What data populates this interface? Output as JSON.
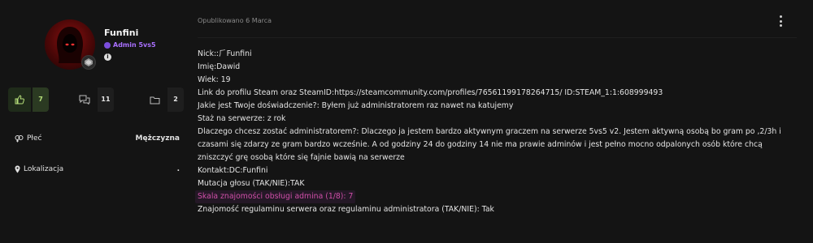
{
  "author": {
    "name": "Funfini",
    "role": "Admin 5vs5",
    "info_glyph": "i"
  },
  "stats": {
    "likes": "7",
    "comments": "11",
    "folders": "2"
  },
  "fields": {
    "gender_label": "Płeć",
    "gender_value": "Mężczyzna",
    "location_label": "Lokalizacja",
    "location_value": "."
  },
  "post": {
    "date": "Opublikowano 6 Marca",
    "lines": [
      "Nick:ː⺁Funfini",
      "Imię:Dawid",
      "Wiek: 19",
      "Link do profilu Steam oraz SteamID:https://steamcommunity.com/profiles/76561199178264715/ ID:STEAM_1:1:608999493",
      "Jakie jest Twoje doświadczenie?: Byłem już administratorem raz nawet na katujemy",
      "Staż na serwerze: z rok",
      "Dlaczego chcesz zostać administratorem?: Dlaczego ja jestem bardzo aktywnym graczem na serwerze 5vs5 v2. Jestem aktywną osobą bo gram po ,2/3h i  czasami się zdarzy ze gram bardzo wcześnie. A od godziny 24 do godziny 14 nie ma prawie adminów i jest pełno mocno odpalonych osób które chcą zniszczyć grę osobą które się fajnie bawią na serwerze",
      "Kontakt:DC:Funfini",
      "Mutacja głosu (TAK/NIE):TAK",
      "Skala znajomości obsługi admina (1/8): 7",
      "Znajomość regulaminu serwera oraz regulaminu administratora (TAK/NIE): Tak"
    ]
  },
  "colors": {
    "background": "#141414",
    "role": "#a970ff",
    "highlight_text": "#d04fa8",
    "like_accent": "#b7e07a"
  },
  "icons": [
    "thumbs-up-icon",
    "comments-icon",
    "folder-icon",
    "gender-icon",
    "location-pin-icon",
    "more-vertical-icon",
    "rank-badge-icon",
    "role-badge-icon",
    "info-icon"
  ]
}
